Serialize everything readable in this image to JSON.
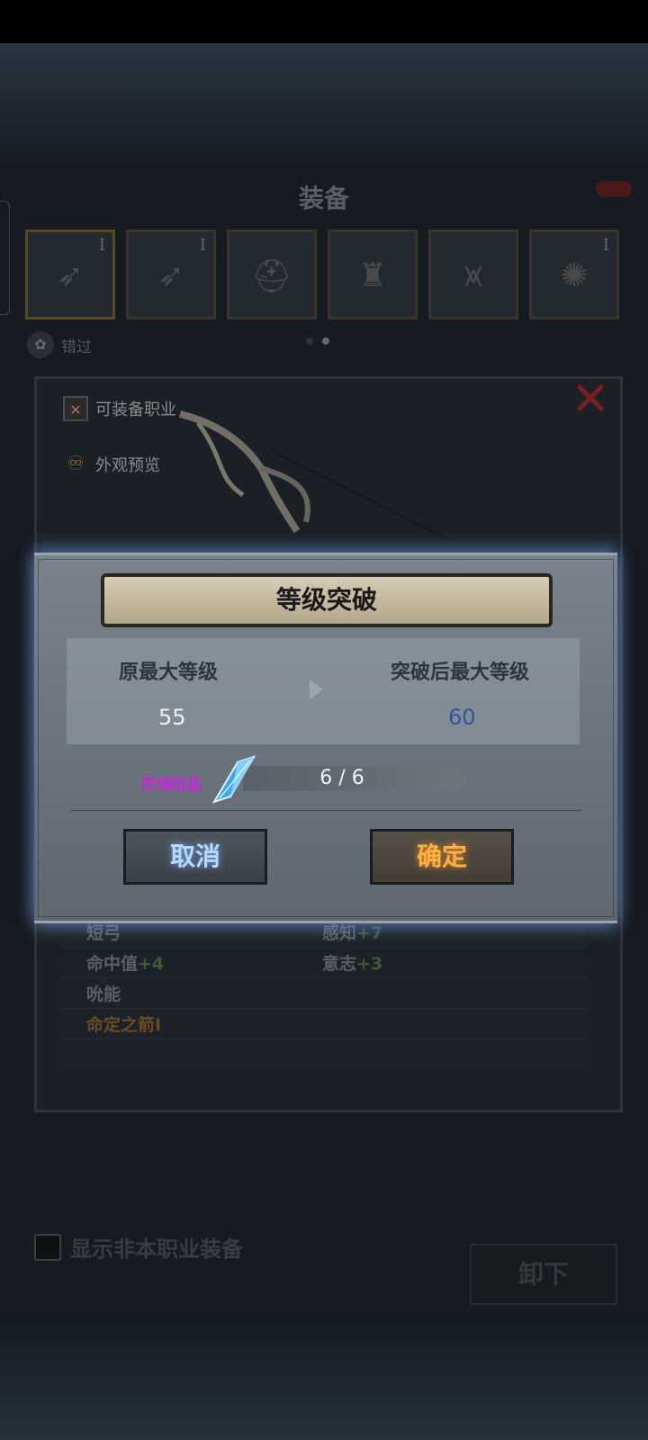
{
  "equip_panel": {
    "title": "装备",
    "slots": [
      {
        "roman": "I",
        "glyph": "➶"
      },
      {
        "roman": "I",
        "glyph": "➶"
      },
      {
        "roman": "",
        "glyph": "⛑"
      },
      {
        "roman": "",
        "glyph": "♜"
      },
      {
        "roman": "",
        "glyph": "⩙"
      },
      {
        "roman": "I",
        "glyph": "✺"
      }
    ],
    "filter_label": "错过"
  },
  "detail": {
    "equip_class_label": "可装备职业",
    "appearance_label": "外观预览",
    "stats": [
      {
        "left": "短弓",
        "right_name": "感知",
        "right_bonus": "+7"
      },
      {
        "left_name": "命中值",
        "left_bonus": "+4",
        "right_name": "意志",
        "right_bonus": "+3"
      },
      {
        "left": "吮能"
      },
      {
        "left": "命定之箭I"
      }
    ]
  },
  "footer": {
    "show_label": "显示非本职业装备",
    "unequip_label": "卸下"
  },
  "dialog": {
    "title": "等级突破",
    "orig_max_label": "原最大等级",
    "new_max_label": "突破后最大等级",
    "orig_max_value": "55",
    "new_max_value": "60",
    "material_name": "灵魂结晶",
    "material_count": "6 / 6",
    "cancel_label": "取消",
    "confirm_label": "确定"
  },
  "colors": {
    "cancel_text": "#b8d8ff",
    "confirm_text": "#ffb040",
    "material_name": "#c22ad8",
    "new_value": "#3552a0"
  }
}
